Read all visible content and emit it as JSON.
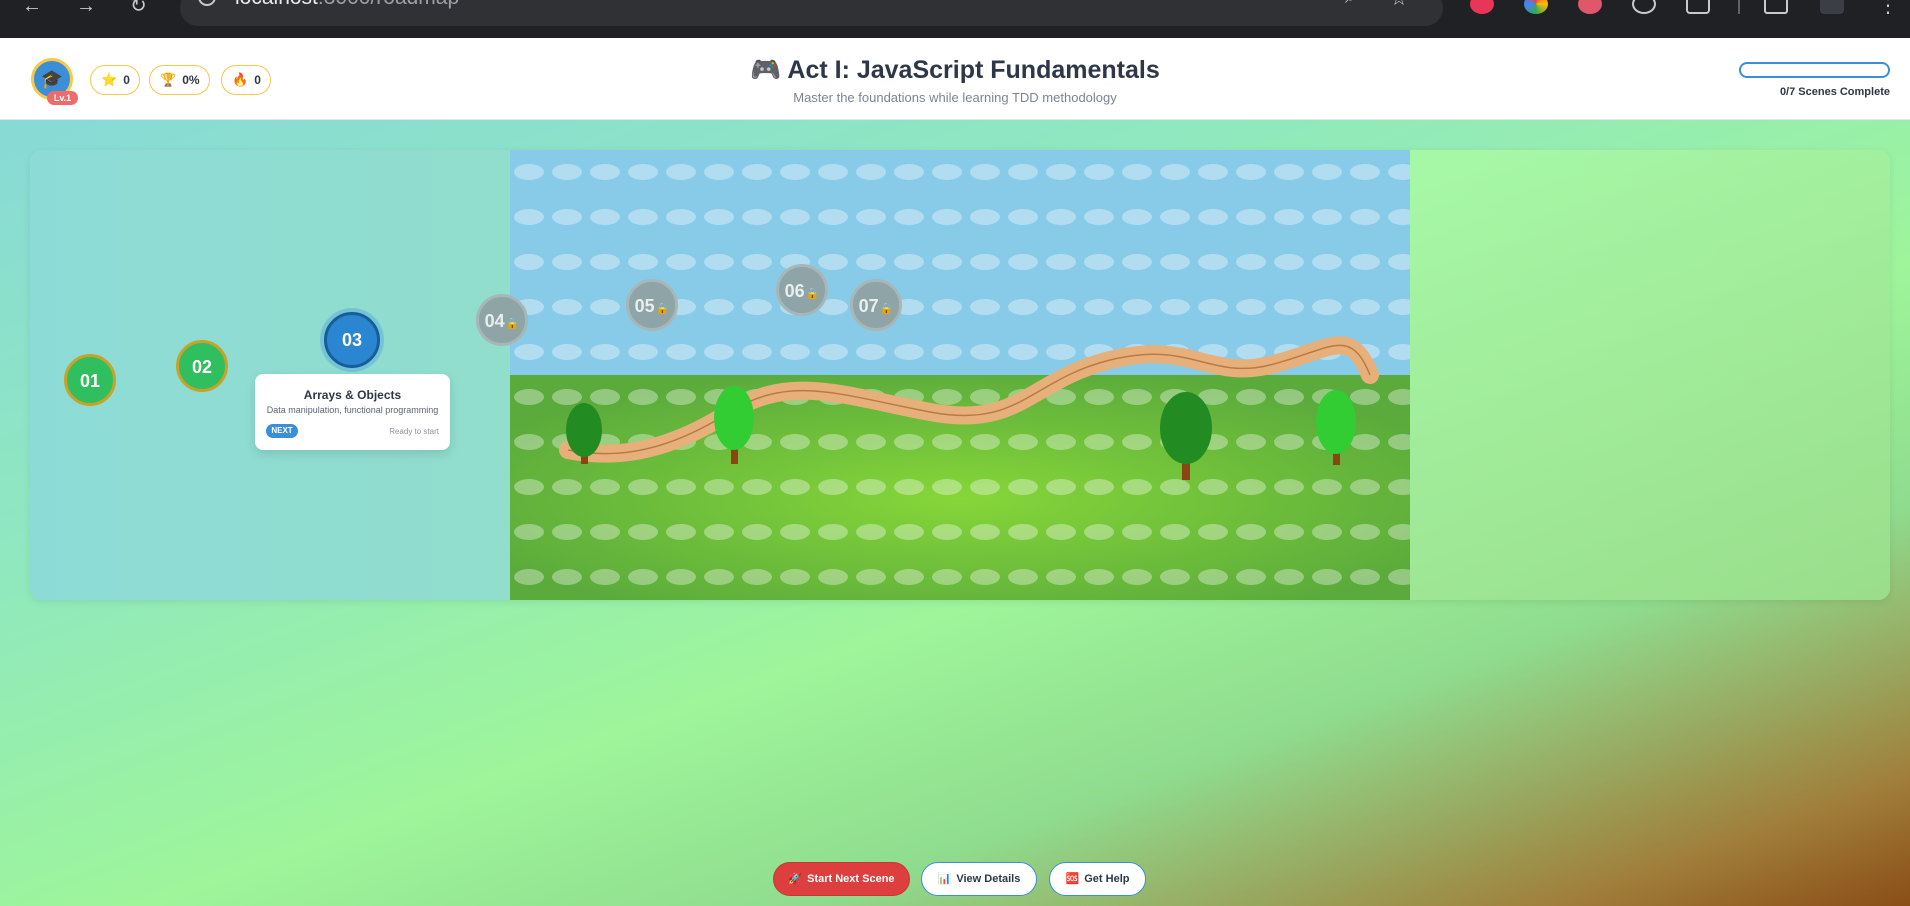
{
  "browser": {
    "url_host": "localhost",
    "url_rest": ":3000/roadmap",
    "back_icon": "←",
    "forward_icon": "→",
    "reload_icon": "↻",
    "zoom_icon": "⌕",
    "star_icon": "☆",
    "menu_icon": "⋮"
  },
  "header": {
    "level_badge": "Lv.1",
    "avatar_icon": "🎓",
    "stats": [
      {
        "icon": "⭐",
        "value": "0"
      },
      {
        "icon": "🏆",
        "value": "0%"
      },
      {
        "icon": "🔥",
        "value": "0"
      }
    ],
    "title": "🎮 Act I: JavaScript Fundamentals",
    "subtitle": "Master the foundations while learning TDD methodology",
    "progress_text": "0/7 Scenes Complete",
    "progress_fraction": 0
  },
  "map": {
    "nodes": [
      {
        "label": "01",
        "state": "done"
      },
      {
        "label": "02",
        "state": "done"
      },
      {
        "label": "03",
        "state": "current"
      },
      {
        "label": "04",
        "state": "locked"
      },
      {
        "label": "05",
        "state": "locked"
      },
      {
        "label": "06",
        "state": "locked"
      },
      {
        "label": "07",
        "state": "locked"
      }
    ],
    "lock_icon": "🔒",
    "card": {
      "title": "Arrays & Objects",
      "description": "Data manipulation, functional programming",
      "badge": "NEXT",
      "status": "Ready to start"
    }
  },
  "actions": {
    "start_label": "Start Next Scene",
    "start_icon": "🚀",
    "details_label": "View Details",
    "details_icon": "📊",
    "help_label": "Get Help",
    "help_icon": "🆘"
  },
  "colors": {
    "accent": "#3a8fd8",
    "primary_button": "#dd3e3e",
    "done_node": "#2fbf5f",
    "locked_node": "#8ea4a6"
  }
}
